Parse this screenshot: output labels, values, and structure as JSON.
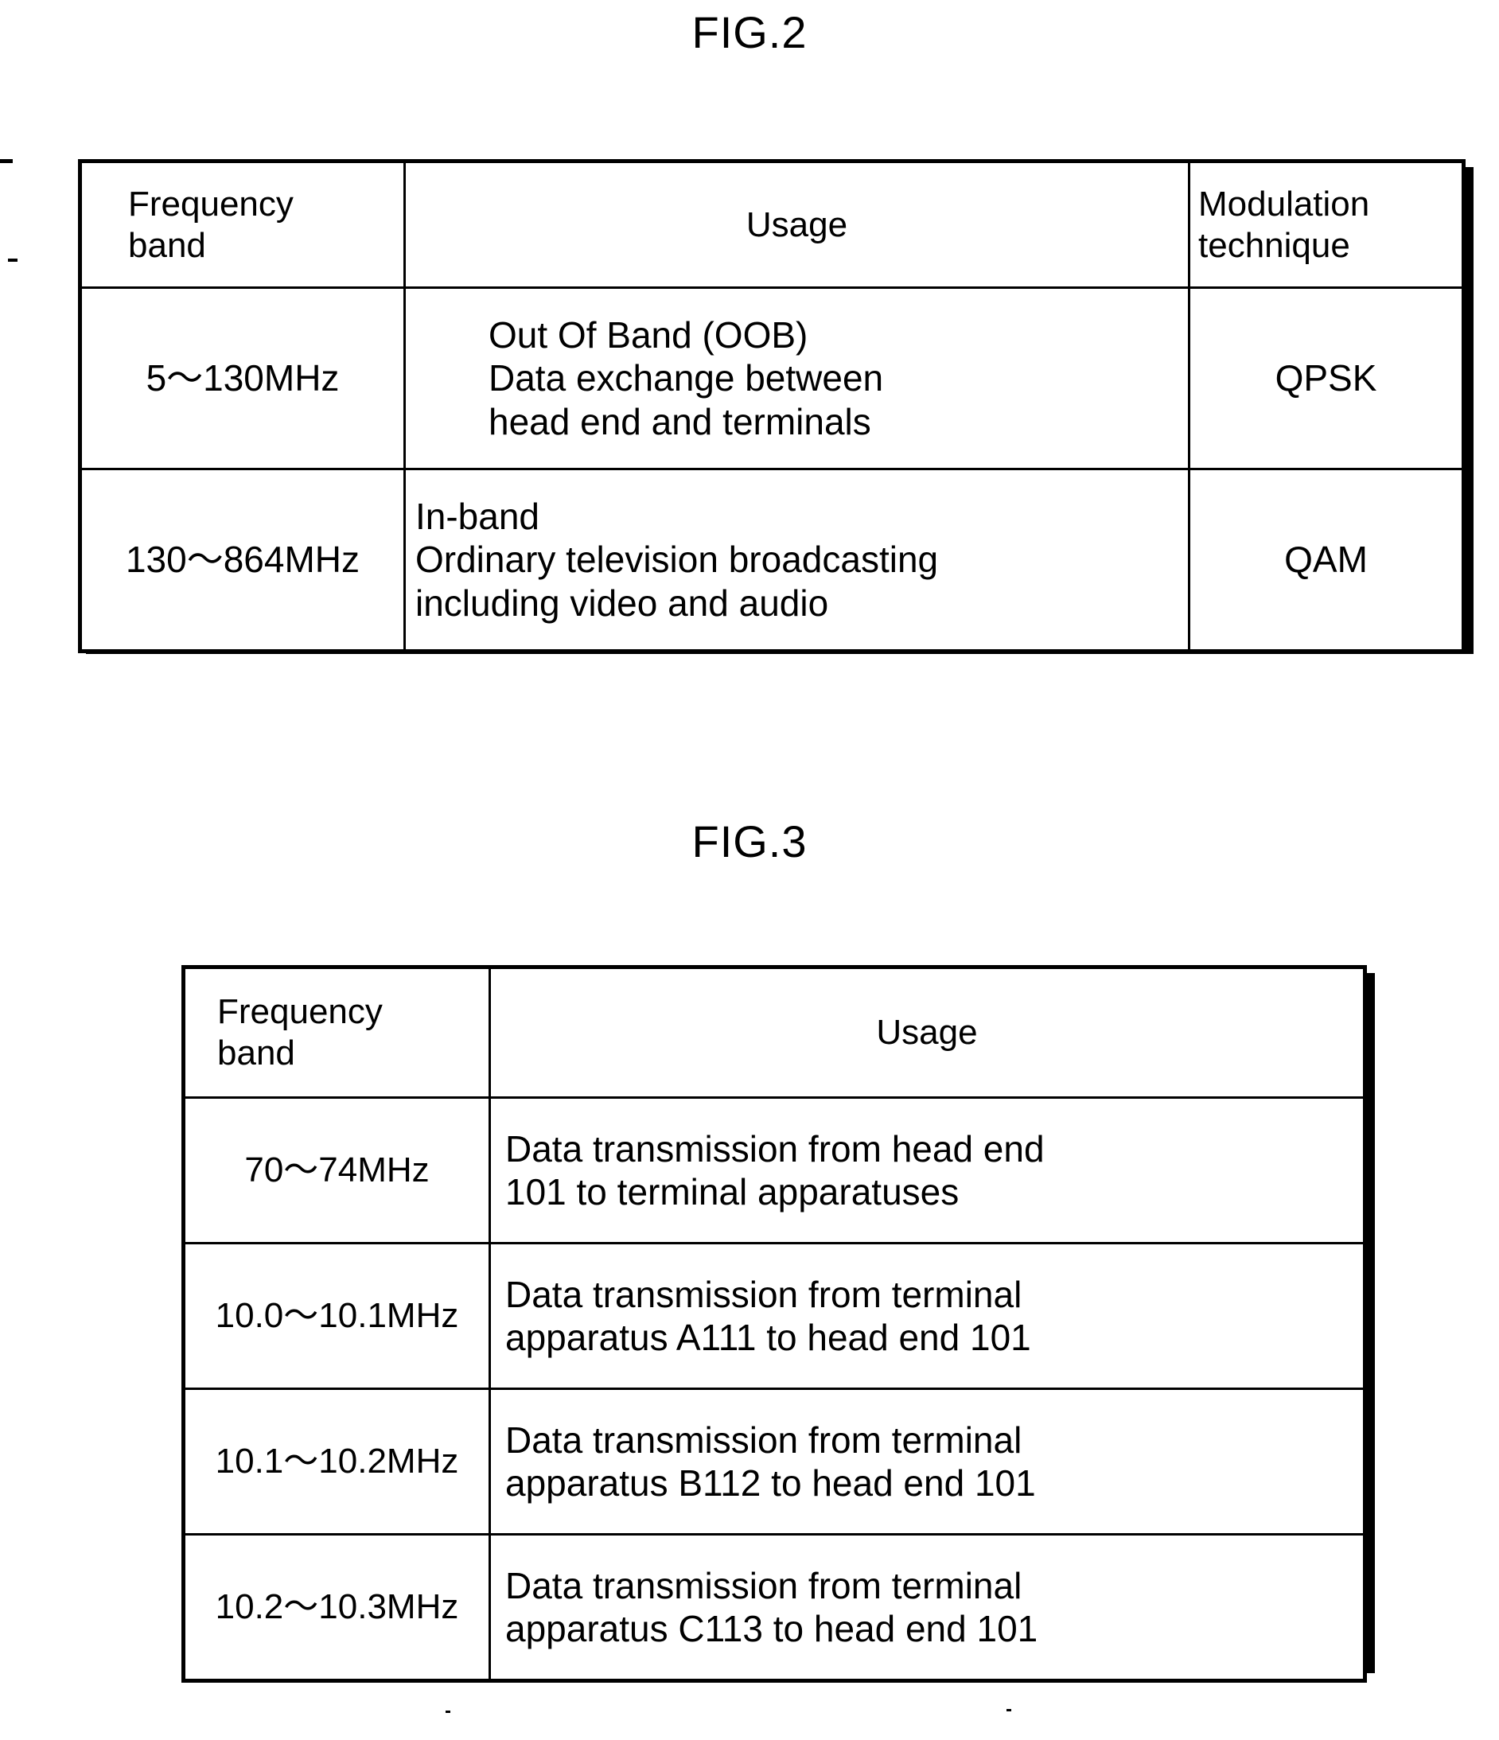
{
  "figures": [
    {
      "id": "fig2",
      "title": "FIG.2",
      "table": {
        "headers": {
          "band_line1": "Frequency",
          "band_line2": "band",
          "usage": "Usage",
          "modulation_line1": "Modulation",
          "modulation_line2": "technique"
        },
        "rows": [
          {
            "band": "5〜130MHz",
            "usage_lines": [
              "Out Of Band (OOB)",
              "Data exchange between",
              "head end and terminals"
            ],
            "modulation": "QPSK"
          },
          {
            "band": "130〜864MHz",
            "usage_lines": [
              "In-band",
              "Ordinary television broadcasting",
              "including video and audio"
            ],
            "modulation": "QAM"
          }
        ]
      }
    },
    {
      "id": "fig3",
      "title": "FIG.3",
      "table": {
        "headers": {
          "band_line1": "Frequency",
          "band_line2": "band",
          "usage": "Usage"
        },
        "rows": [
          {
            "band": "70〜74MHz",
            "usage_lines": [
              "Data transmission from head end",
              "101 to terminal apparatuses"
            ]
          },
          {
            "band": "10.0〜10.1MHz",
            "usage_lines": [
              "Data transmission from terminal",
              "apparatus A111 to head end 101"
            ]
          },
          {
            "band": "10.1〜10.2MHz",
            "usage_lines": [
              "Data transmission from terminal",
              "apparatus B112 to head end 101"
            ]
          },
          {
            "band": "10.2〜10.3MHz",
            "usage_lines": [
              "Data transmission from terminal",
              "apparatus C113 to head end 101"
            ]
          }
        ]
      }
    }
  ],
  "colors": {
    "ink": "#000000",
    "paper": "#ffffff"
  }
}
